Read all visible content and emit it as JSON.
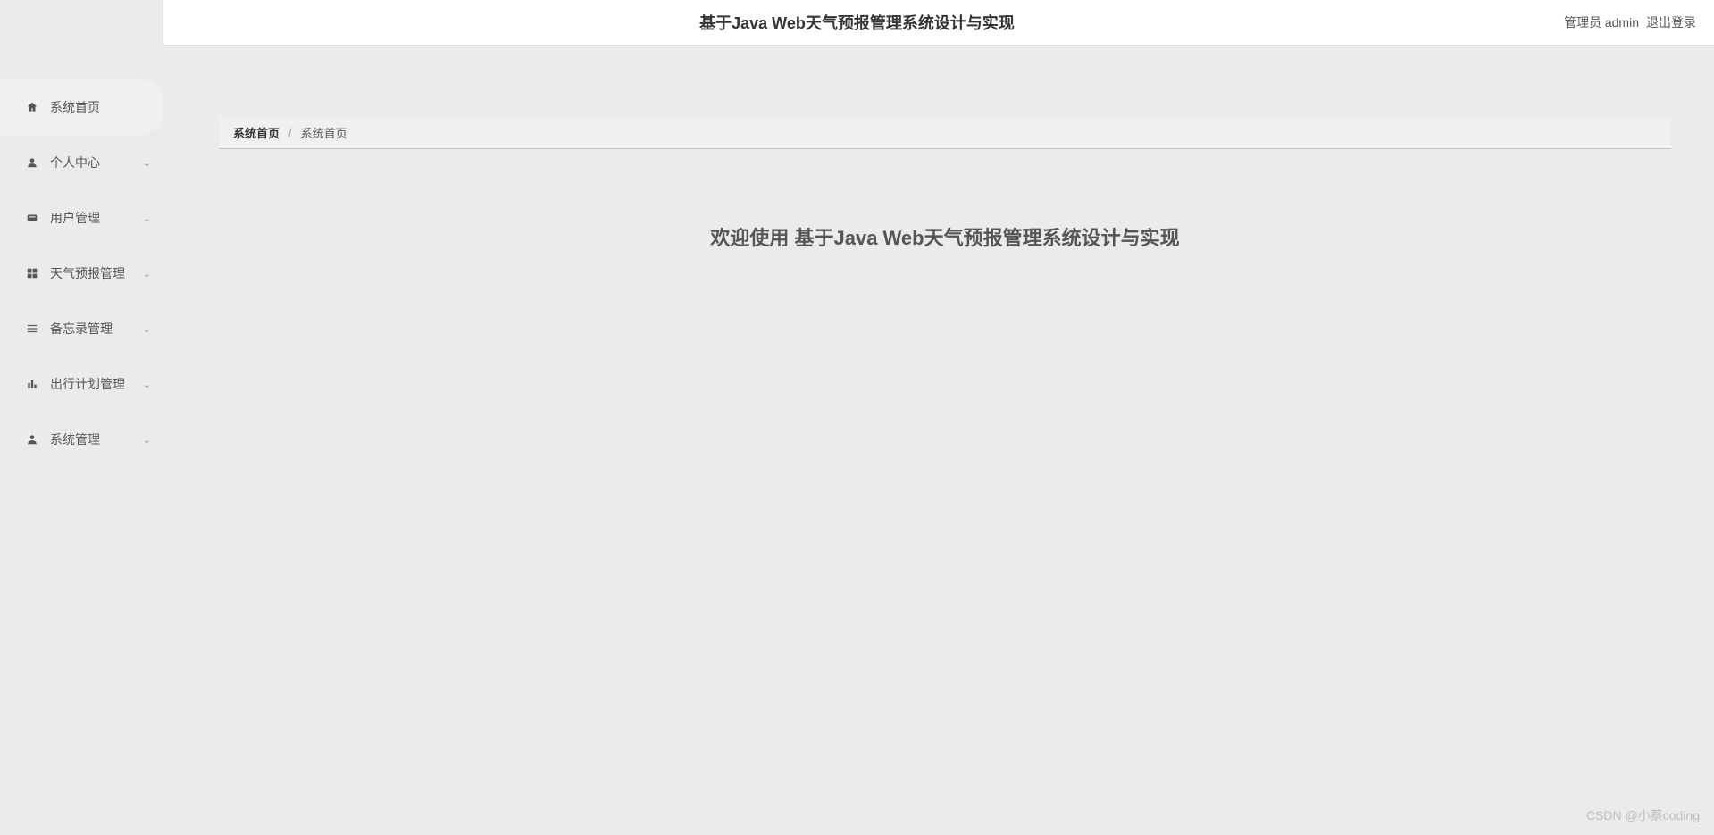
{
  "header": {
    "title": "基于Java Web天气预报管理系统设计与实现",
    "user_label": "管理员 admin",
    "logout_label": "退出登录"
  },
  "sidebar": {
    "items": [
      {
        "icon": "home-icon",
        "label": "系统首页",
        "expandable": false
      },
      {
        "icon": "person-icon",
        "label": "个人中心",
        "expandable": true
      },
      {
        "icon": "users-icon",
        "label": "用户管理",
        "expandable": true
      },
      {
        "icon": "grid-icon",
        "label": "天气预报管理",
        "expandable": true
      },
      {
        "icon": "list-icon",
        "label": "备忘录管理",
        "expandable": true
      },
      {
        "icon": "chart-icon",
        "label": "出行计划管理",
        "expandable": true
      },
      {
        "icon": "admin-icon",
        "label": "系统管理",
        "expandable": true
      }
    ]
  },
  "breadcrumb": {
    "first": "系统首页",
    "second": "系统首页"
  },
  "main": {
    "welcome": "欢迎使用 基于Java Web天气预报管理系统设计与实现"
  },
  "watermark": "CSDN @小蔡coding"
}
